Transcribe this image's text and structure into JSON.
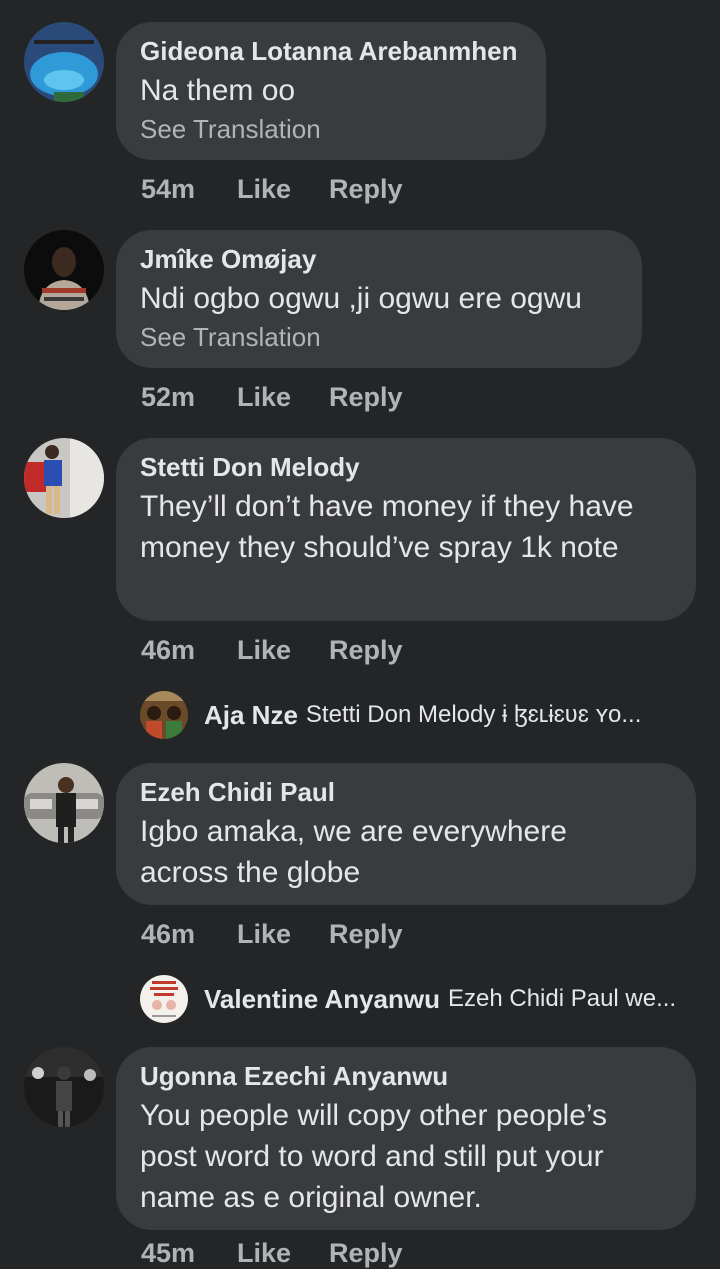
{
  "comments": [
    {
      "name": "Gideona Lotanna Arebanmhen",
      "text": [
        "Na them oo"
      ],
      "see_translation": "See Translation",
      "time": "54m",
      "like": "Like",
      "reply": "Reply"
    },
    {
      "name": "Jmîke Omøjay",
      "text": [
        "Ndi ogbo ogwu ,ji ogwu ere ogwu"
      ],
      "see_translation": "See Translation",
      "time": "52m",
      "like": "Like",
      "reply": "Reply"
    },
    {
      "name": "Stetti Don Melody",
      "text": [
        "They’ll don’t have money if they have",
        "money they should’ve spray 1k note"
      ],
      "time": "46m",
      "like": "Like",
      "reply": "Reply",
      "reply_preview": {
        "name": "Aja Nze",
        "text": "Stetti Don Melody ɨ ɮɛʟɨɛʋɛ ʏo..."
      }
    },
    {
      "name": "Ezeh Chidi Paul",
      "text": [
        "Igbo amaka, we are everywhere",
        "across the globe"
      ],
      "time": "46m",
      "like": "Like",
      "reply": "Reply",
      "reply_preview": {
        "name": "Valentine Anyanwu",
        "text": "Ezeh Chidi Paul we..."
      }
    },
    {
      "name": "Ugonna Ezechi Anyanwu",
      "text": [
        "You people will copy other people’s",
        "post word to word and still put your",
        "name as e original owner."
      ],
      "time": "45m",
      "like": "Like",
      "reply": "Reply"
    }
  ],
  "colors": {
    "background": "#242526",
    "bubble": "#3a3b3c",
    "primary_text": "#e4e6eb",
    "secondary_text": "#b0b3b8"
  }
}
